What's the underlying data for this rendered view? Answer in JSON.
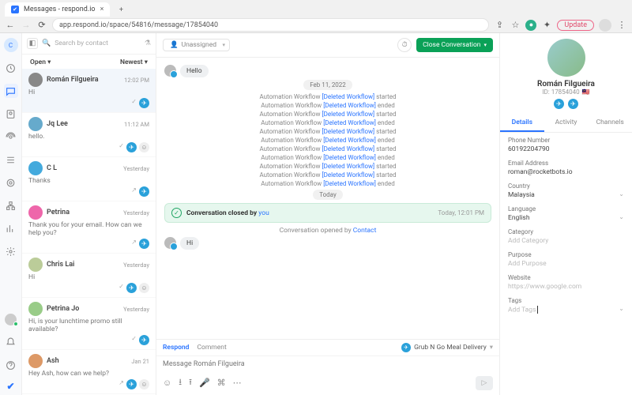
{
  "browser": {
    "tab_title": "Messages - respond.io",
    "url": "app.respond.io/space/54816/message/17854040",
    "update": "Update"
  },
  "rail_user": "C",
  "toolbar": {
    "search_placeholder": "Search by contact",
    "open": "Open",
    "newest": "Newest"
  },
  "unassigned": "Unassigned",
  "close_conversation": "Close Conversation",
  "conversations": [
    {
      "name": "Román Filgueira",
      "time": "12:02 PM",
      "preview": "Hi",
      "color": "#888",
      "sel": true,
      "icons": [
        "chk",
        "tg"
      ]
    },
    {
      "name": "Jq Lee",
      "time": "11:12 AM",
      "preview": "hello.",
      "color": "#6ac",
      "icons": [
        "chk",
        "tg",
        "pin"
      ]
    },
    {
      "name": "C L",
      "time": "Yesterday",
      "preview": "Thanks",
      "color": "#4ad",
      "icons": [
        "out",
        "tg"
      ]
    },
    {
      "name": "Petrina",
      "time": "Yesterday",
      "preview": "Thank you for your email. How can we help you?",
      "color": "#e6a",
      "icons": [
        "out",
        "tg"
      ]
    },
    {
      "name": "Chris Lai",
      "time": "Yesterday",
      "preview": "Hi",
      "color": "#bc9",
      "icons": [
        "chk",
        "tg",
        "pin"
      ]
    },
    {
      "name": "Petrina Jo",
      "time": "Yesterday",
      "preview": "Hi, is your lunchtime promo still available?",
      "color": "#9c8",
      "icons": [
        "chk",
        "tg"
      ]
    },
    {
      "name": "Ash",
      "time": "Jan 21",
      "preview": "Hey Ash, how can we help?",
      "color": "#d96",
      "icons": [
        "out",
        "tg",
        "pin"
      ]
    }
  ],
  "thread": {
    "hello": "Hello",
    "hi": "Hi",
    "date_chip": "Feb 11, 2022",
    "today": "Today",
    "wf_prefix": "Automation Workflow ",
    "wf_link": "[Deleted Workflow]",
    "wf": [
      "started",
      "ended",
      "started",
      "ended",
      "started",
      "ended",
      "started",
      "ended",
      "started",
      "started",
      "ended"
    ],
    "closed_prefix": "Conversation closed by ",
    "closed_by": "you",
    "closed_time": "Today, 12:01 PM",
    "opened_prefix": "Conversation opened by ",
    "opened_by": "Contact"
  },
  "composer": {
    "respond": "Respond",
    "comment": "Comment",
    "channel": "Grub N Go Meal Delivery",
    "placeholder": "Message Román Filgueira"
  },
  "profile": {
    "name": "Román Filgueira",
    "id": "ID: 17854040",
    "tabs": {
      "details": "Details",
      "activity": "Activity",
      "channels": "Channels"
    },
    "fields": [
      {
        "l": "Phone Number",
        "v": "60192204790"
      },
      {
        "l": "Email Address",
        "v": "roman@rocketbots.io"
      },
      {
        "l": "Country",
        "v": "Malaysia",
        "dd": true
      },
      {
        "l": "Language",
        "v": "English",
        "dd": true
      },
      {
        "l": "Category",
        "v": "Add Category",
        "ph": true
      },
      {
        "l": "Purpose",
        "v": "Add Purpose",
        "ph": true
      },
      {
        "l": "Website",
        "v": "https://www.google.com",
        "ph": true
      },
      {
        "l": "Tags",
        "v": "Add Tags",
        "ph": true,
        "dd": true,
        "cursor": true
      }
    ]
  }
}
